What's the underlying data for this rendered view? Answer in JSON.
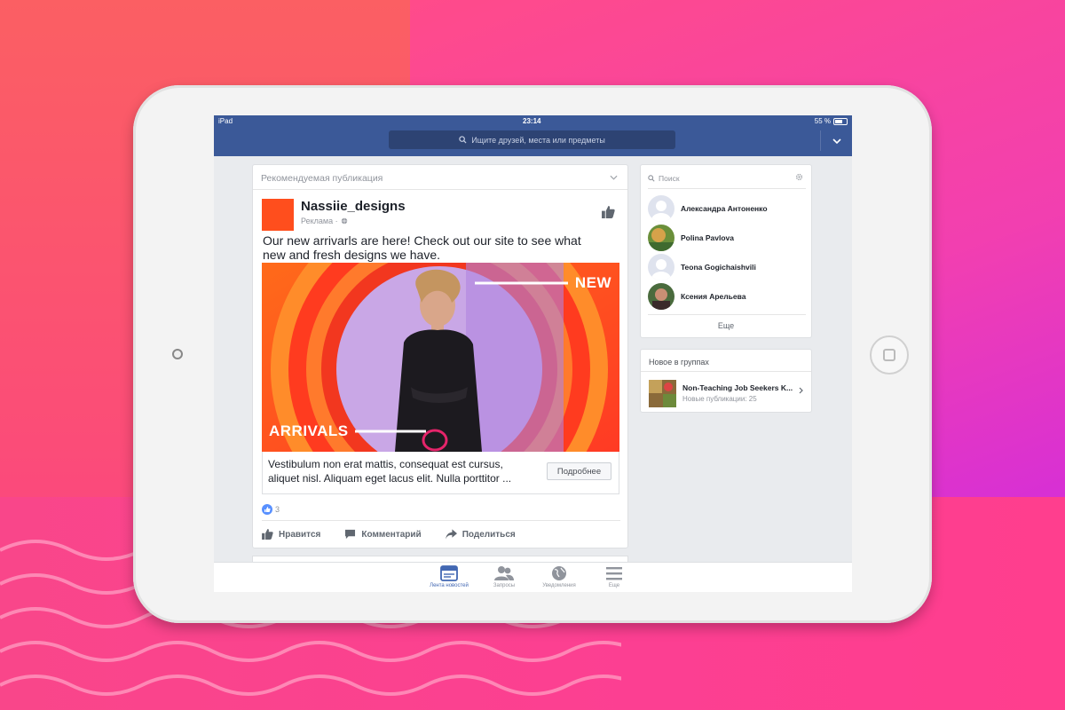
{
  "status_bar": {
    "carrier": "iPad",
    "time": "23:14",
    "battery": "55 %"
  },
  "search": {
    "placeholder": "Ищите друзей, места или предметы"
  },
  "post": {
    "header": "Рекомендуемая публикация",
    "page_name": "Nassiie_designs",
    "sponsored": "Реклама ·",
    "text": "Our new arrivarls are here! Check out our site to see what new and fresh designs we have.",
    "image_text_new": "NEW",
    "image_text_arrivals": "ARRIVALS",
    "ad_description": "Vestibulum non erat mattis, consequat est cursus, aliquet nisl. Aliquam eget lacus elit. Nulla porttitor ...",
    "cta_label": "Подробнее",
    "like_count": "3",
    "actions": {
      "like": "Нравится",
      "comment": "Комментарий",
      "share": "Поделиться"
    },
    "brand_color": "#ff4e1d"
  },
  "sidebar": {
    "search_placeholder": "Поиск",
    "friends": [
      {
        "name": "Александра Антоненко"
      },
      {
        "name": "Polina Pavlova"
      },
      {
        "name": "Teona Gogichaishvili"
      },
      {
        "name": "Ксения Арельева"
      }
    ],
    "more_label": "Еще"
  },
  "groups": {
    "title": "Новое в группах",
    "item_name": "Non-Teaching Job Seekers K...",
    "item_sub": "Новые публикации: 25"
  },
  "tabbar": {
    "items": [
      {
        "label": "Лента новостей",
        "icon": "news-feed-icon",
        "active": true
      },
      {
        "label": "Запросы",
        "icon": "friend-requests-icon",
        "active": false
      },
      {
        "label": "Уведомления",
        "icon": "globe-icon",
        "active": false
      },
      {
        "label": "Еще",
        "icon": "menu-icon",
        "active": false
      }
    ]
  },
  "colors": {
    "facebook_blue": "#3b5998",
    "background_pink": "#fb4d77"
  }
}
